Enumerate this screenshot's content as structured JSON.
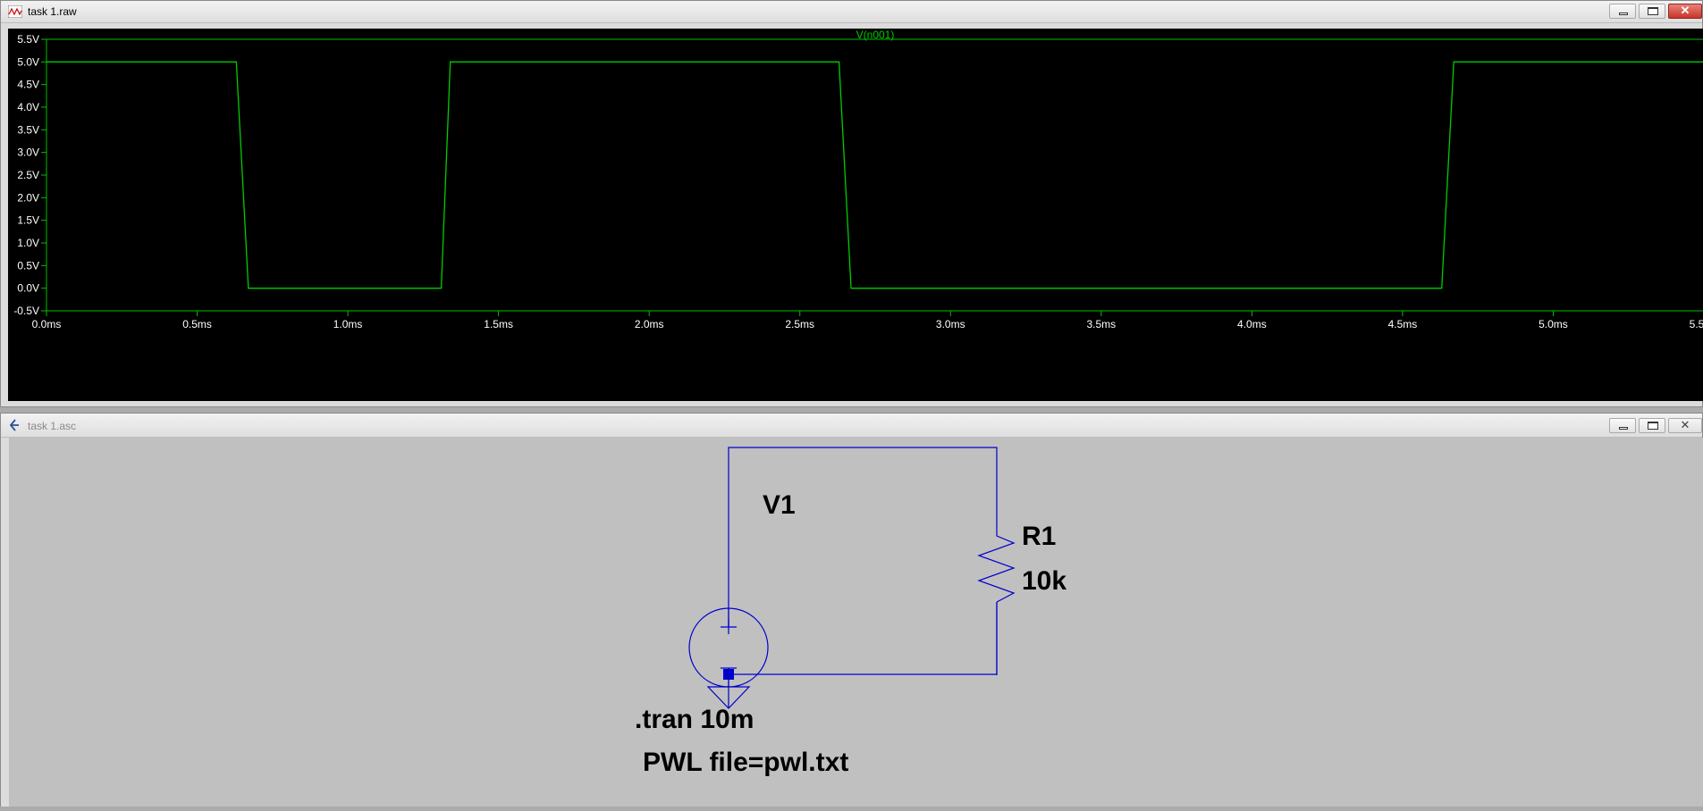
{
  "waveform_window": {
    "title": "task 1.raw",
    "trace_name": "V(n001)",
    "trace_color": "#00cc00",
    "background": "#000000"
  },
  "schematic_window": {
    "title": "task 1.asc",
    "wire_color": "#0000cc",
    "background": "#c0c0c0",
    "source_label": "V1",
    "resistor_label": "R1",
    "resistor_value": "10k",
    "directive": ".tran 10m",
    "source_value": "PWL file=pwl.txt"
  },
  "chart_data": {
    "type": "line",
    "title": "V(n001)",
    "xlabel": "",
    "ylabel": "",
    "xlim": [
      0,
      5.5
    ],
    "ylim": [
      -0.5,
      5.5
    ],
    "x_ticks": [
      "0.0ms",
      "0.5ms",
      "1.0ms",
      "1.5ms",
      "2.0ms",
      "2.5ms",
      "3.0ms",
      "3.5ms",
      "4.0ms",
      "4.5ms",
      "5.0ms",
      "5.5ms"
    ],
    "y_ticks": [
      "5.5V",
      "5.0V",
      "4.5V",
      "4.0V",
      "3.5V",
      "3.0V",
      "2.5V",
      "2.0V",
      "1.5V",
      "1.0V",
      "0.5V",
      "0.0V",
      "-0.5V"
    ],
    "grid": false,
    "series": [
      {
        "name": "V(n001)",
        "x": [
          0,
          0.63,
          0.67,
          1.31,
          1.34,
          2.63,
          2.67,
          4.63,
          4.67,
          5.5
        ],
        "y": [
          5,
          5,
          0,
          0,
          5,
          5,
          0,
          0,
          5,
          5
        ]
      }
    ]
  }
}
